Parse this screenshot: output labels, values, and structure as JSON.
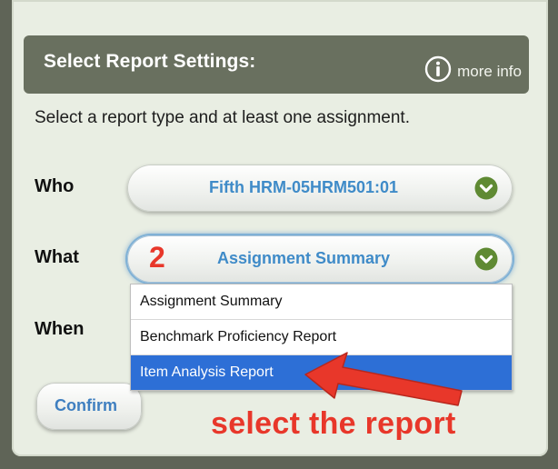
{
  "header": {
    "title": "Select Report Settings:",
    "info_label": "more info"
  },
  "intro": "Select a report type and at least one assignment.",
  "who": {
    "label": "Who",
    "value": "Fifth HRM-05HRM501:01"
  },
  "what": {
    "label": "What",
    "step_number": "2",
    "value": "Assignment Summary",
    "options": [
      "Assignment Summary",
      "Benchmark Proficiency Report",
      "Item Analysis Report"
    ],
    "highlighted_option": "Item Analysis Report"
  },
  "when": {
    "label": "When"
  },
  "confirm_label": "Confirm",
  "annotation": {
    "text": "select the report"
  },
  "colors": {
    "header_bg": "#69705f",
    "panel_bg": "#e9eee3",
    "link_blue": "#3f8bc8",
    "chevron_green": "#5f8a33",
    "selection_blue": "#2d6fd6",
    "annotation_red": "#e8372a"
  },
  "icons": {
    "info": "info-circle-icon",
    "dropdown": "chevron-down-circle-icon",
    "annotation": "red-arrow-icon"
  }
}
